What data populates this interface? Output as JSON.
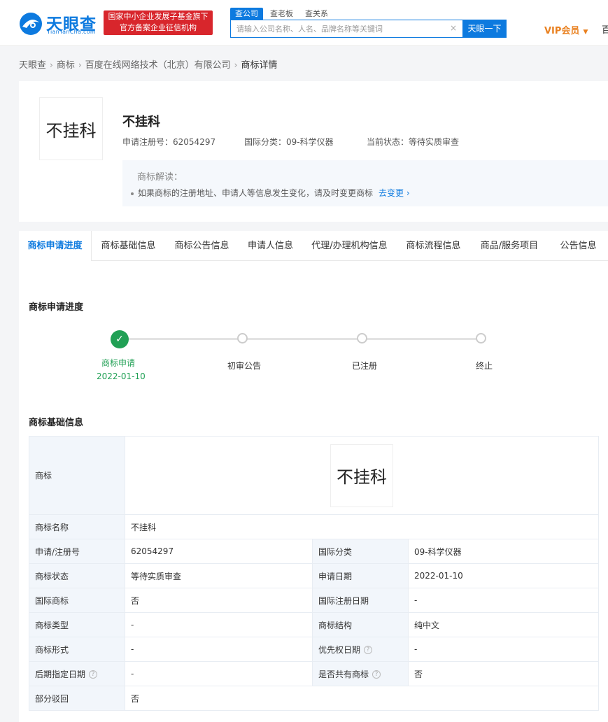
{
  "header": {
    "logo_cn": "天眼查",
    "logo_en": "TianYanCha.com",
    "banner_line1": "国家中小企业发展子基金旗下",
    "banner_line2": "官方备案企业征信机构",
    "search_tabs": [
      "查公司",
      "查老板",
      "查关系"
    ],
    "search_placeholder": "请输入公司名称、人名、品牌名称等关键词",
    "search_button": "天眼一下",
    "vip_label": "VIP会员",
    "cut_text": "百"
  },
  "breadcrumb": [
    "天眼查",
    "商标",
    "百度在线网络技术（北京）有限公司",
    "商标详情"
  ],
  "trademark": {
    "image_text": "不挂科",
    "name": "不挂科",
    "reg_no_label": "申请注册号：",
    "reg_no": "62054297",
    "class_label": "国际分类：",
    "class": "09-科学仪器",
    "status_label": "当前状态：",
    "status": "等待实质审查"
  },
  "note": {
    "title": "商标解读：",
    "text": "如果商标的注册地址、申请人等信息发生变化，请及时变更商标",
    "link": "去变更"
  },
  "tabs": [
    "商标申请进度",
    "商标基础信息",
    "商标公告信息",
    "申请人信息",
    "代理/办理机构信息",
    "商标流程信息",
    "商品/服务项目",
    "公告信息"
  ],
  "progress": {
    "title": "商标申请进度",
    "steps": [
      {
        "label": "商标申请",
        "date": "2022-01-10",
        "done": true
      },
      {
        "label": "初审公告",
        "date": "",
        "done": false
      },
      {
        "label": "已注册",
        "date": "",
        "done": false
      },
      {
        "label": "终止",
        "date": "",
        "done": false
      }
    ]
  },
  "basic": {
    "title": "商标基础信息",
    "rows": {
      "tm_label": "商标",
      "name_label": "商标名称",
      "name": "不挂科",
      "regno_label": "申请/注册号",
      "regno": "62054297",
      "class_label": "国际分类",
      "class": "09-科学仪器",
      "status_label": "商标状态",
      "status": "等待实质审查",
      "appdate_label": "申请日期",
      "appdate": "2022-01-10",
      "intl_label": "国际商标",
      "intl": "否",
      "intldate_label": "国际注册日期",
      "intldate": "-",
      "type_label": "商标类型",
      "type": "-",
      "structure_label": "商标结构",
      "structure": "纯中文",
      "form_label": "商标形式",
      "form": "-",
      "priority_label": "优先权日期",
      "priority": "-",
      "later_label": "后期指定日期",
      "later": "-",
      "shared_label": "是否共有商标",
      "shared": "否",
      "partial_label": "部分驳回",
      "partial": "否"
    }
  }
}
